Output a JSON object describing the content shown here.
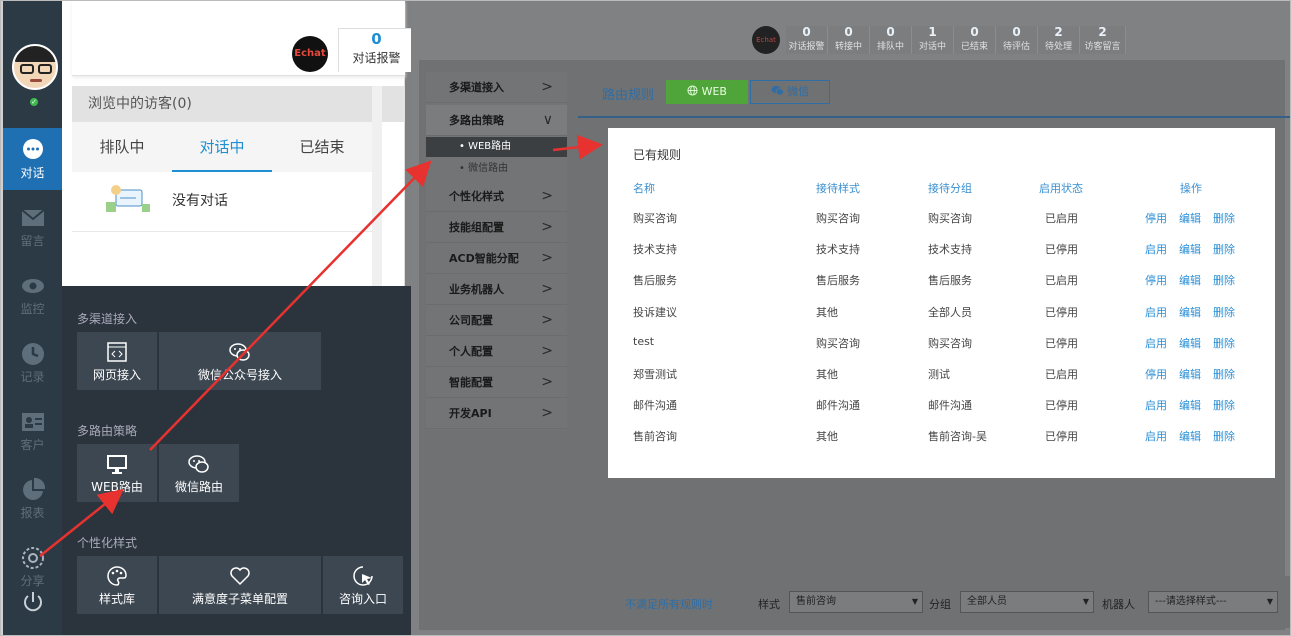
{
  "nav": {
    "items": [
      {
        "label": "对话",
        "icon": "chat-bubble-icon",
        "active": true
      },
      {
        "label": "留言",
        "icon": "mail-icon"
      },
      {
        "label": "监控",
        "icon": "eye-icon"
      },
      {
        "label": "记录",
        "icon": "clock-icon"
      },
      {
        "label": "客户",
        "icon": "contact-card-icon"
      },
      {
        "label": "报表",
        "icon": "pie-chart-icon"
      },
      {
        "label": "分享",
        "icon": "gear-icon"
      }
    ]
  },
  "chat": {
    "logo_text": "Echat",
    "alarm_count": "0",
    "alarm_label": "对话报警",
    "visitor_header": "浏览中的访客(0)",
    "tabs": [
      "排队中",
      "对话中",
      "已结束"
    ],
    "active_tab": 1,
    "empty_text": "没有对话"
  },
  "settings_menu": {
    "sections": [
      {
        "title": "多渠道接入",
        "tiles": [
          "网页接入",
          "微信公众号接入"
        ]
      },
      {
        "title": "多路由策略",
        "tiles": [
          "WEB路由",
          "微信路由"
        ]
      },
      {
        "title": "个性化样式",
        "tiles": [
          "样式库",
          "满意度子菜单配置",
          "咨询入口"
        ]
      }
    ]
  },
  "stats": {
    "logo_text": "Echat",
    "items": [
      {
        "n": "0",
        "t": "对话报警"
      },
      {
        "n": "0",
        "t": "转接中"
      },
      {
        "n": "0",
        "t": "排队中"
      },
      {
        "n": "1",
        "t": "对话中"
      },
      {
        "n": "0",
        "t": "已结束"
      },
      {
        "n": "0",
        "t": "待评估"
      },
      {
        "n": "2",
        "t": "待处理"
      },
      {
        "n": "2",
        "t": "访客留言"
      }
    ]
  },
  "side_menu": {
    "items": [
      "多渠道接入",
      "多路由策略",
      "个性化样式",
      "技能组配置",
      "ACD智能分配",
      "业务机器人",
      "公司配置",
      "个人配置",
      "智能配置",
      "开发API"
    ],
    "subitems": [
      "WEB路由",
      "微信路由"
    ]
  },
  "route": {
    "title": "路由规则",
    "web_btn": "WEB",
    "wechat_btn": "微信"
  },
  "rules": {
    "title": "已有规则",
    "headers": [
      "名称",
      "接待样式",
      "接待分组",
      "启用状态",
      "操作"
    ],
    "rows": [
      {
        "name": "购买咨询",
        "style": "购买咨询",
        "group": "购买咨询",
        "status": "已启用",
        "toggle": "停用"
      },
      {
        "name": "技术支持",
        "style": "技术支持",
        "group": "技术支持",
        "status": "已停用",
        "toggle": "启用"
      },
      {
        "name": "售后服务",
        "style": "售后服务",
        "group": "售后服务",
        "status": "已启用",
        "toggle": "停用"
      },
      {
        "name": "投诉建议",
        "style": "其他",
        "group": "全部人员",
        "status": "已停用",
        "toggle": "启用"
      },
      {
        "name": "test",
        "style": "购买咨询",
        "group": "购买咨询",
        "status": "已停用",
        "toggle": "启用"
      },
      {
        "name": "郑雪测试",
        "style": "其他",
        "group": "测试",
        "status": "已启用",
        "toggle": "停用"
      },
      {
        "name": "邮件沟通",
        "style": "邮件沟通",
        "group": "邮件沟通",
        "status": "已停用",
        "toggle": "启用"
      },
      {
        "name": "售前咨询",
        "style": "其他",
        "group": "售前咨询-吴",
        "status": "已停用",
        "toggle": "启用"
      }
    ],
    "edit_label": "编辑",
    "delete_label": "删除"
  },
  "bottom": {
    "fallback_label": "不满足所有规则时",
    "style_label": "样式",
    "style_value": "售前咨询",
    "group_label": "分组",
    "group_value": "全部人员",
    "robot_label": "机器人",
    "robot_value": "---请选择样式---"
  },
  "colors": {
    "nav_bg": "#2b3a45",
    "nav_active": "#1f6fb3",
    "accent_blue": "#1f8fd3",
    "web_green": "#4fa53a",
    "arrow_red": "#e8322f"
  }
}
